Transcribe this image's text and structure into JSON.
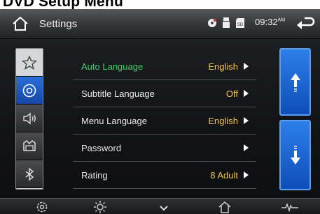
{
  "caption": "DVD Setup Menu",
  "header": {
    "title": "Settings",
    "time": "09:32",
    "ampm": "AM",
    "status_icons": [
      "disc-icon",
      "usb-icon",
      "sd-card-icon"
    ]
  },
  "sidebar": {
    "items": [
      {
        "name": "favorites",
        "icon": "star-icon",
        "active": false
      },
      {
        "name": "dvd",
        "icon": "disc-icon",
        "active": true
      },
      {
        "name": "audio",
        "icon": "speaker-icon",
        "active": false
      },
      {
        "name": "vehicle",
        "icon": "car-icon",
        "active": false
      },
      {
        "name": "bluetooth",
        "icon": "bluetooth-icon",
        "active": false
      }
    ]
  },
  "menu": {
    "items": [
      {
        "label": "Auto Language",
        "value": "English",
        "active": true
      },
      {
        "label": "Subtitle Language",
        "value": "Off",
        "active": false
      },
      {
        "label": "Menu Language",
        "value": "English",
        "active": false
      },
      {
        "label": "Password",
        "value": "",
        "active": false
      },
      {
        "label": "Rating",
        "value": "8 Adult",
        "active": false
      }
    ]
  },
  "scroll": {
    "up_icon": "arrow-up-icon",
    "down_icon": "arrow-down-icon"
  },
  "bottombar": {
    "icons": [
      "settings-gear-icon",
      "brightness-icon",
      "chevron-down-icon",
      "home-icon",
      "equalizer-icon"
    ]
  },
  "colors": {
    "accent_blue": "#2b6fd8",
    "active_green": "#3ed16a",
    "value_yellow": "#f1c34a"
  }
}
